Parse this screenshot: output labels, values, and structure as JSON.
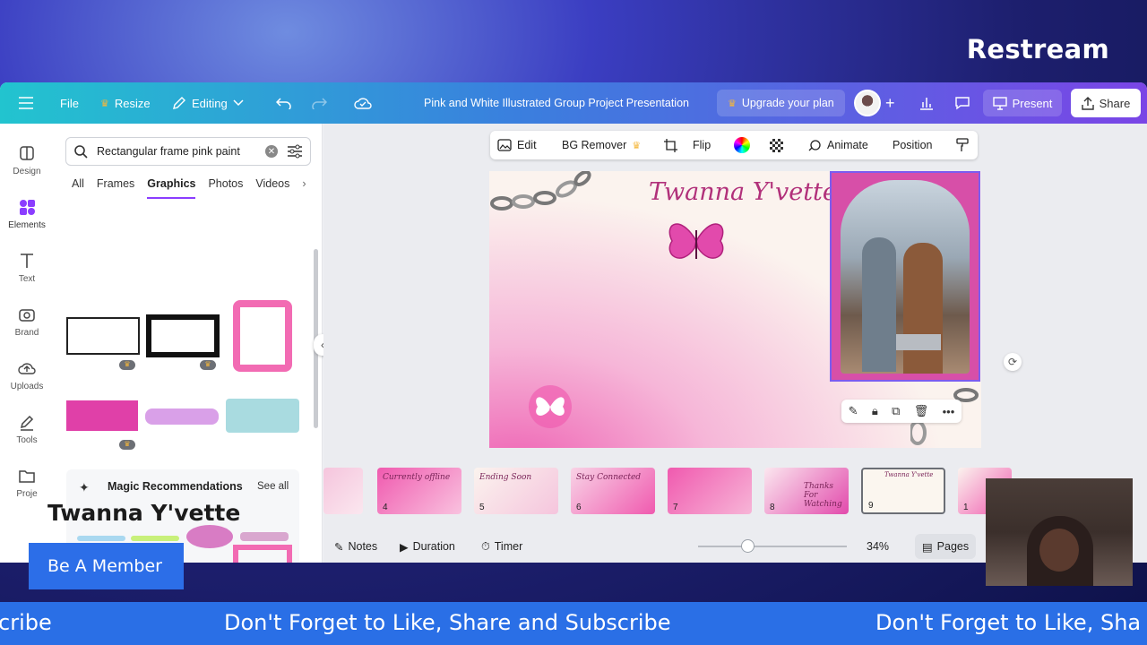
{
  "overlay": {
    "brand": "Restream",
    "streamer_name": "Twanna Y'vette",
    "cta": "Be A Member",
    "ticker_text": "Don't Forget to Like, Share and Subscribe",
    "ticker_left": "cribe",
    "ticker_right": "Don't Forget to Like, Sha"
  },
  "topbar": {
    "file": "File",
    "resize": "Resize",
    "editing": "Editing",
    "doc_title": "Pink and White Illustrated Group Project Presentation",
    "upgrade": "Upgrade your plan",
    "present": "Present",
    "share": "Share"
  },
  "rail": [
    {
      "label": "Design",
      "icon": "layout-icon"
    },
    {
      "label": "Elements",
      "icon": "shapes-icon"
    },
    {
      "label": "Text",
      "icon": "text-icon"
    },
    {
      "label": "Brand",
      "icon": "brand-icon"
    },
    {
      "label": "Uploads",
      "icon": "cloud-upload-icon"
    },
    {
      "label": "Tools",
      "icon": "pen-icon"
    },
    {
      "label": "Proje",
      "icon": "folder-icon"
    }
  ],
  "panel": {
    "search_value": "Rectangular frame pink paint",
    "tabs": [
      "All",
      "Frames",
      "Graphics",
      "Photos",
      "Videos"
    ],
    "active_tab": "Graphics",
    "magic_title": "Magic Recommendations",
    "see_all": "See all"
  },
  "context_bar": {
    "edit": "Edit",
    "bg_remover": "BG Remover",
    "flip": "Flip",
    "animate": "Animate",
    "position": "Position"
  },
  "slide": {
    "title": "Twanna Y'vette"
  },
  "thumbnails": [
    {
      "num": "4",
      "caption": "Currently offline"
    },
    {
      "num": "5",
      "caption": "Ending Soon"
    },
    {
      "num": "6",
      "caption": "Stay Connected"
    },
    {
      "num": "7",
      "caption": ""
    },
    {
      "num": "8",
      "caption": "Thanks For Watching"
    },
    {
      "num": "9",
      "caption": "Twanna Y'vette"
    },
    {
      "num": "1",
      "caption": ""
    }
  ],
  "footer": {
    "notes": "Notes",
    "duration": "Duration",
    "timer": "Timer",
    "zoom": "34%",
    "zoom_level": 0.34,
    "pages": "Pages"
  },
  "colors": {
    "accent": "#8b3dff",
    "pink": "#d74fa8",
    "ticker_blue": "#2a6fe6"
  }
}
